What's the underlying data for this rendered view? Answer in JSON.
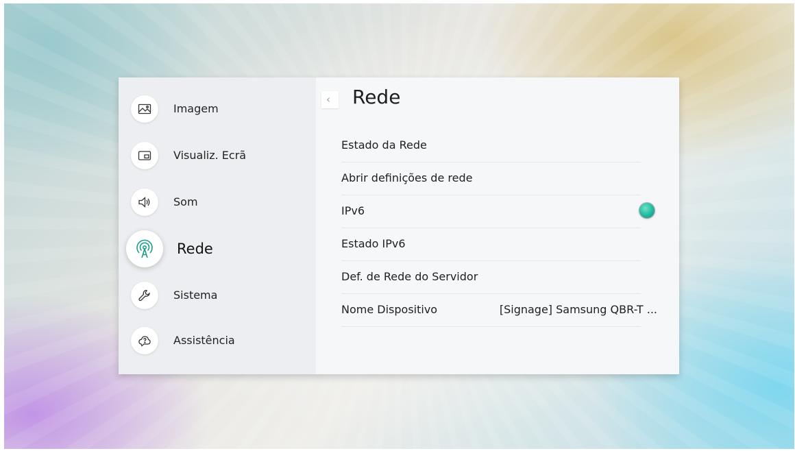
{
  "sidebar": {
    "items": [
      {
        "label": "Imagem",
        "icon": "picture-icon",
        "active": false
      },
      {
        "label": "Visualiz. Ecrã",
        "icon": "pip-screen-icon",
        "active": false
      },
      {
        "label": "Som",
        "icon": "speaker-icon",
        "active": false
      },
      {
        "label": "Rede",
        "icon": "antenna-icon",
        "active": true
      },
      {
        "label": "Sistema",
        "icon": "wrench-icon",
        "active": false
      },
      {
        "label": "Assistência",
        "icon": "help-cloud-icon",
        "active": false
      }
    ]
  },
  "content": {
    "back_icon": "chevron-left-icon",
    "back_glyph": "‹",
    "title": "Rede",
    "rows": [
      {
        "label": "Estado da Rede"
      },
      {
        "label": "Abrir definições de rede"
      },
      {
        "label": "IPv6",
        "toggle": true,
        "toggle_on": true,
        "toggle_color": "#1fb89e"
      },
      {
        "label": "Estado IPv6"
      },
      {
        "label": "Def. de Rede do Servidor"
      },
      {
        "label": "Nome Dispositivo",
        "value": "[Signage] Samsung QBR-T ..."
      }
    ]
  },
  "colors": {
    "panel": "#f2f4f6",
    "sidebar": "#eceef1",
    "accent_toggle": "#1fb89e"
  }
}
